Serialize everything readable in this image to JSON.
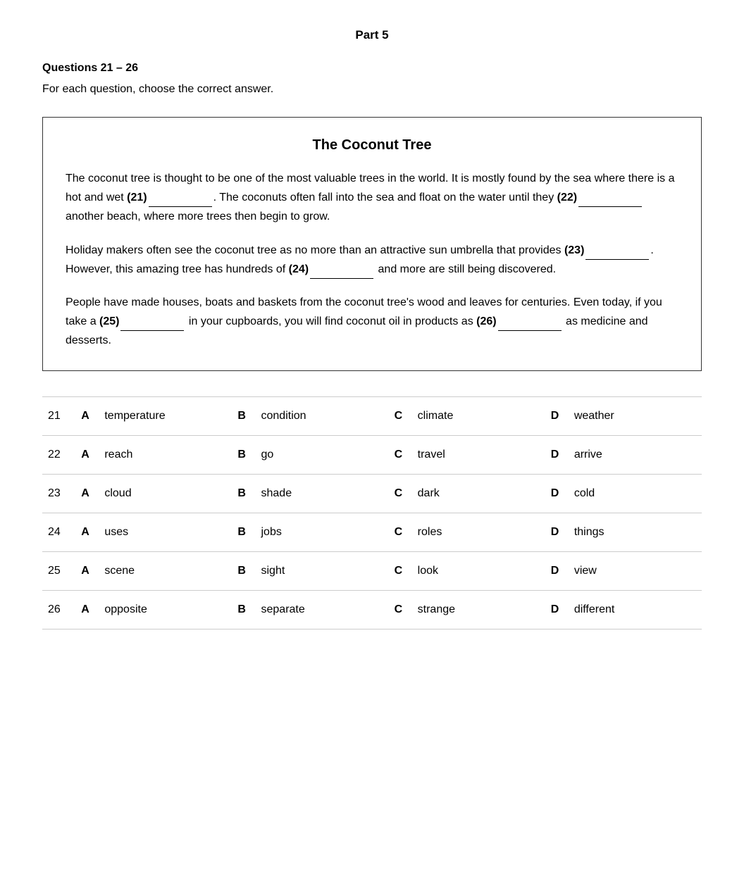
{
  "header": {
    "title": "Part 5"
  },
  "questions_label": "Questions 21 – 26",
  "instruction": "For each question, choose the correct answer.",
  "passage": {
    "title": "The Coconut Tree",
    "paragraphs": [
      {
        "id": "p1",
        "text_before": "The coconut tree is thought to be one of the most valuable trees in the world. It is mostly found by the sea where there is a hot and wet",
        "blank1_label": "(21)",
        "text_middle": ". The coconuts often fall into the sea and float on the water until they",
        "blank2_label": "(22)",
        "text_after": "another beach, where more trees then begin to grow."
      },
      {
        "id": "p2",
        "text_before": "Holiday makers often see the coconut tree as no more than an attractive sun umbrella that provides",
        "blank1_label": "(23)",
        "text_middle": ". However, this amazing tree has hundreds of",
        "blank2_label": "(24)",
        "text_after": "and more are still being discovered."
      },
      {
        "id": "p3",
        "text_before": "People have made houses, boats and baskets from the coconut tree's wood and leaves for centuries. Even today, if you take a",
        "blank1_label": "(25)",
        "text_middle": "in your cupboards, you will find coconut oil in products as",
        "blank2_label": "(26)",
        "text_after": "as medicine and desserts."
      }
    ]
  },
  "questions": [
    {
      "number": "21",
      "options": [
        {
          "letter": "A",
          "text": "temperature"
        },
        {
          "letter": "B",
          "text": "condition"
        },
        {
          "letter": "C",
          "text": "climate"
        },
        {
          "letter": "D",
          "text": "weather"
        }
      ]
    },
    {
      "number": "22",
      "options": [
        {
          "letter": "A",
          "text": "reach"
        },
        {
          "letter": "B",
          "text": "go"
        },
        {
          "letter": "C",
          "text": "travel"
        },
        {
          "letter": "D",
          "text": "arrive"
        }
      ]
    },
    {
      "number": "23",
      "options": [
        {
          "letter": "A",
          "text": "cloud"
        },
        {
          "letter": "B",
          "text": "shade"
        },
        {
          "letter": "C",
          "text": "dark"
        },
        {
          "letter": "D",
          "text": "cold"
        }
      ]
    },
    {
      "number": "24",
      "options": [
        {
          "letter": "A",
          "text": "uses"
        },
        {
          "letter": "B",
          "text": "jobs"
        },
        {
          "letter": "C",
          "text": "roles"
        },
        {
          "letter": "D",
          "text": "things"
        }
      ]
    },
    {
      "number": "25",
      "options": [
        {
          "letter": "A",
          "text": "scene"
        },
        {
          "letter": "B",
          "text": "sight"
        },
        {
          "letter": "C",
          "text": "look"
        },
        {
          "letter": "D",
          "text": "view"
        }
      ]
    },
    {
      "number": "26",
      "options": [
        {
          "letter": "A",
          "text": "opposite"
        },
        {
          "letter": "B",
          "text": "separate"
        },
        {
          "letter": "C",
          "text": "strange"
        },
        {
          "letter": "D",
          "text": "different"
        }
      ]
    }
  ]
}
